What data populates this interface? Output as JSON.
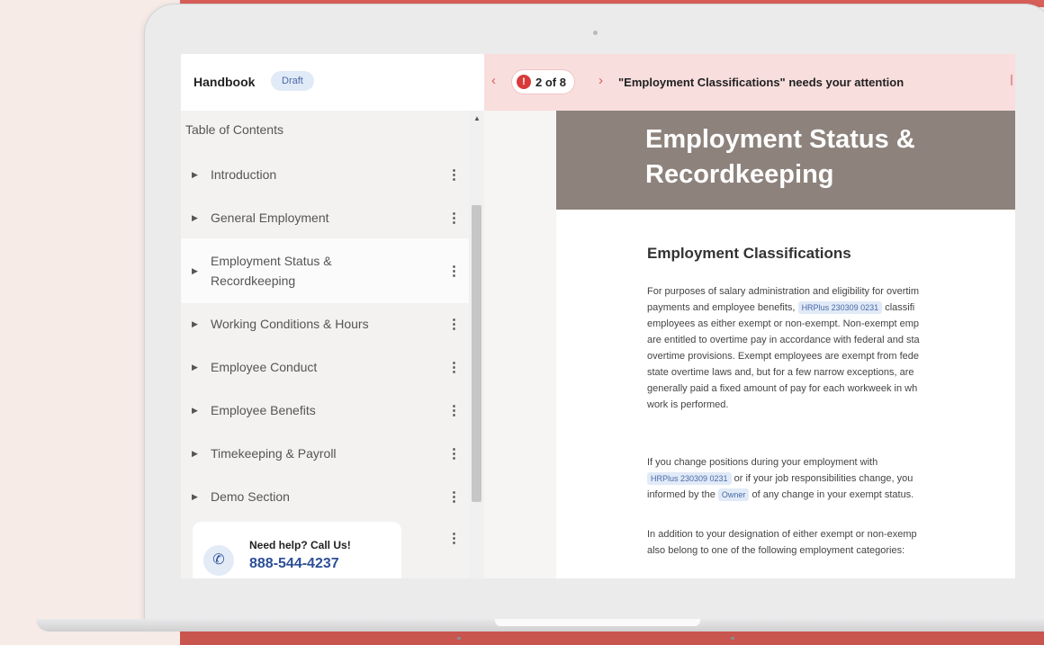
{
  "header": {
    "doc_title": "Handbook",
    "status_badge": "Draft"
  },
  "alert": {
    "counter": "2 of 8",
    "message": "\"Employment Classifications\" needs your attention",
    "color": "#f9dede"
  },
  "sidebar": {
    "toc_title": "Table of Contents",
    "items": [
      {
        "label": "Introduction"
      },
      {
        "label": "General Employment"
      },
      {
        "label_line1": "Employment Status &",
        "label_line2": "Recordkeeping"
      },
      {
        "label": "Working Conditions & Hours"
      },
      {
        "label": "Employee Conduct"
      },
      {
        "label": "Employee Benefits"
      },
      {
        "label": "Timekeeping & Payroll"
      },
      {
        "label": "Demo Section"
      }
    ],
    "help": {
      "title": "Need help? Call Us!",
      "phone": "888-544-4237"
    }
  },
  "content": {
    "banner_line1": "Employment Status &",
    "banner_line2": "Recordkeeping",
    "section_title": "Employment Classifications",
    "company_tag": "HRPlus 230309 0231",
    "owner_tag": "Owner",
    "p1": {
      "l1": "For purposes of salary administration and eligibility for overtim",
      "l2a": "payments and employee benefits,",
      "l2b": "classifi",
      "l3": "employees as either exempt or non-exempt. Non-exempt emp",
      "l4": "are entitled to overtime pay in accordance with federal and sta",
      "l5": "overtime provisions. Exempt employees are exempt from fede",
      "l6": "state overtime laws and, but for a few narrow exceptions, are",
      "l7": "generally paid a fixed amount of pay for each workweek in wh",
      "l8": "work is performed."
    },
    "p2": {
      "l1": "If you change positions during your employment with",
      "l2b": "or if your job responsibilities change, you",
      "l3a": "informed by the",
      "l3b": "of any change in your exempt status."
    },
    "p3": {
      "l1": "In addition to your designation of either exempt or non-exemp",
      "l2": "also belong to one of the following employment categories:"
    }
  },
  "colors": {
    "accent_blue": "#2d4f97",
    "banner": "#8d827c",
    "warning": "#d83a3a"
  }
}
